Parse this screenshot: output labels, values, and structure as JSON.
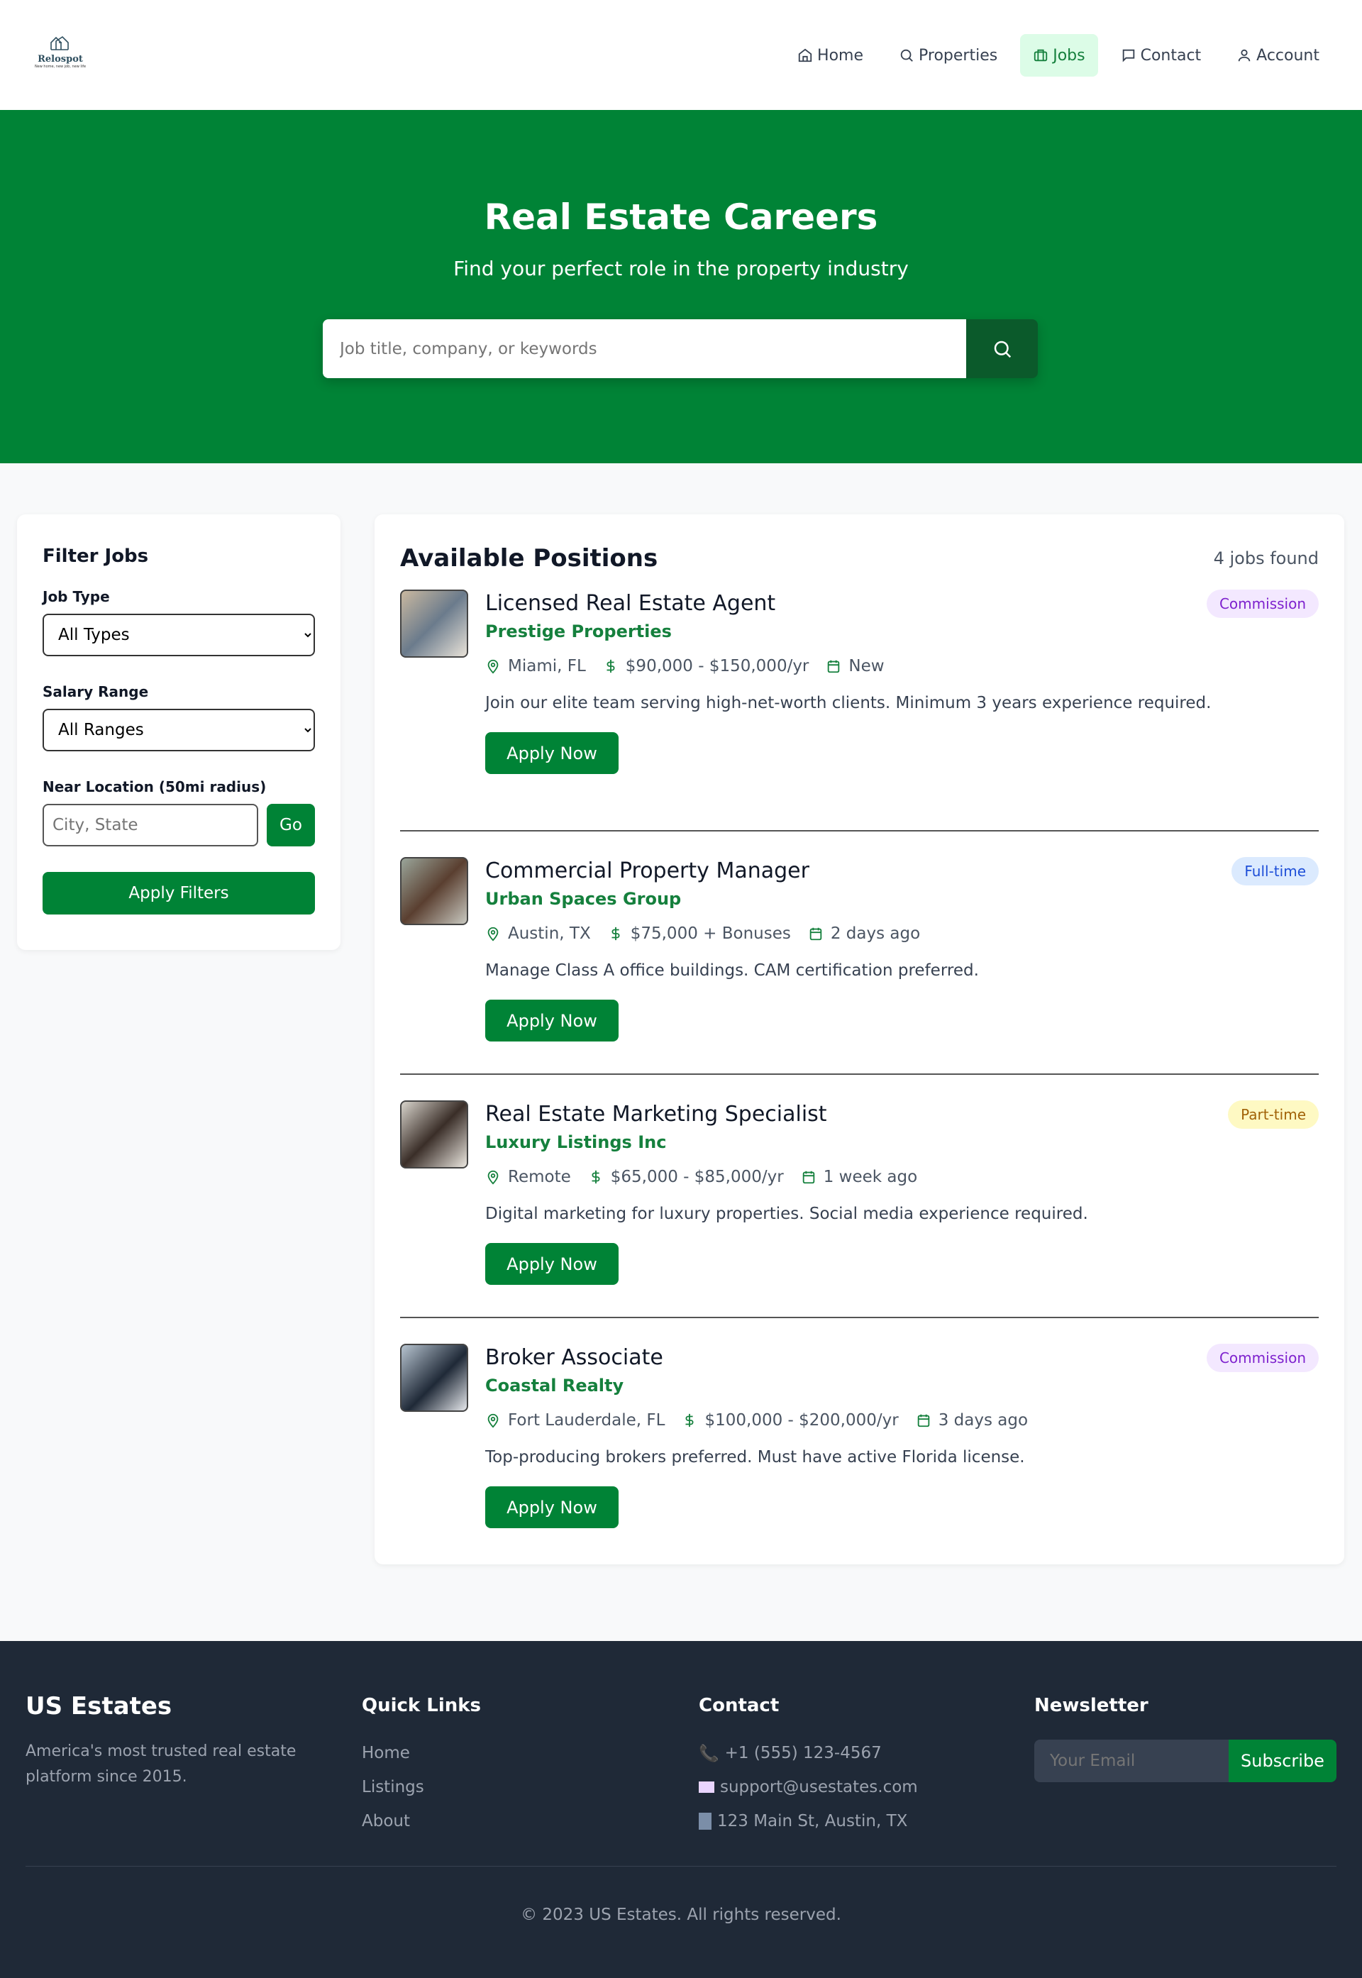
{
  "nav": {
    "logo_brand": "Relospot",
    "logo_tagline": "New home, new job, new life",
    "items": [
      {
        "label": "Home",
        "icon": "home-icon"
      },
      {
        "label": "Properties",
        "icon": "search-icon"
      },
      {
        "label": "Jobs",
        "icon": "briefcase-icon",
        "active": true
      },
      {
        "label": "Contact",
        "icon": "message-icon"
      },
      {
        "label": "Account",
        "icon": "user-icon"
      }
    ]
  },
  "hero": {
    "title": "Real Estate Careers",
    "subtitle": "Find your perfect role in the property industry",
    "search_placeholder": "Job title, company, or keywords"
  },
  "filters": {
    "title": "Filter Jobs",
    "job_type_label": "Job Type",
    "job_type_value": "All Types",
    "salary_label": "Salary Range",
    "salary_value": "All Ranges",
    "location_label": "Near Location (50mi radius)",
    "location_placeholder": "City, State",
    "go_label": "Go",
    "apply_label": "Apply Filters"
  },
  "jobs_header": {
    "title": "Available Positions",
    "count": "4 jobs found"
  },
  "jobs": [
    {
      "title": "Licensed Real Estate Agent",
      "company": "Prestige Properties",
      "location": "Miami, FL",
      "salary": "$90,000 - $150,000/yr",
      "posted": "New",
      "description": "Join our elite team serving high-net-worth clients. Minimum 3 years experience required.",
      "badge": "Commission",
      "badge_bg": "#f3e8ff",
      "badge_color": "#7e22ce",
      "apply": "Apply Now"
    },
    {
      "title": "Commercial Property Manager",
      "company": "Urban Spaces Group",
      "location": "Austin, TX",
      "salary": "$75,000 + Bonuses",
      "posted": "2 days ago",
      "description": "Manage Class A office buildings. CAM certification preferred.",
      "badge": "Full-time",
      "badge_bg": "#dbeafe",
      "badge_color": "#1d4ed8",
      "apply": "Apply Now"
    },
    {
      "title": "Real Estate Marketing Specialist",
      "company": "Luxury Listings Inc",
      "location": "Remote",
      "salary": "$65,000 - $85,000/yr",
      "posted": "1 week ago",
      "description": "Digital marketing for luxury properties. Social media experience required.",
      "badge": "Part-time",
      "badge_bg": "#fef9c3",
      "badge_color": "#a16207",
      "apply": "Apply Now"
    },
    {
      "title": "Broker Associate",
      "company": "Coastal Realty",
      "location": "Fort Lauderdale, FL",
      "salary": "$100,000 - $200,000/yr",
      "posted": "3 days ago",
      "description": "Top-producing brokers preferred. Must have active Florida license.",
      "badge": "Commission",
      "badge_bg": "#f3e8ff",
      "badge_color": "#7e22ce",
      "apply": "Apply Now"
    }
  ],
  "footer": {
    "brand": "US Estates",
    "about": "America's most trusted real estate platform since 2015.",
    "quick_title": "Quick Links",
    "quick_links": [
      "Home",
      "Listings",
      "About"
    ],
    "contact_title": "Contact",
    "phone": "+1 (555) 123-4567",
    "email": "support@usestates.com",
    "address": "123 Main St, Austin, TX",
    "newsletter_title": "Newsletter",
    "email_placeholder": "Your Email",
    "subscribe": "Subscribe",
    "copyright": "© 2023 US Estates. All rights reserved."
  }
}
